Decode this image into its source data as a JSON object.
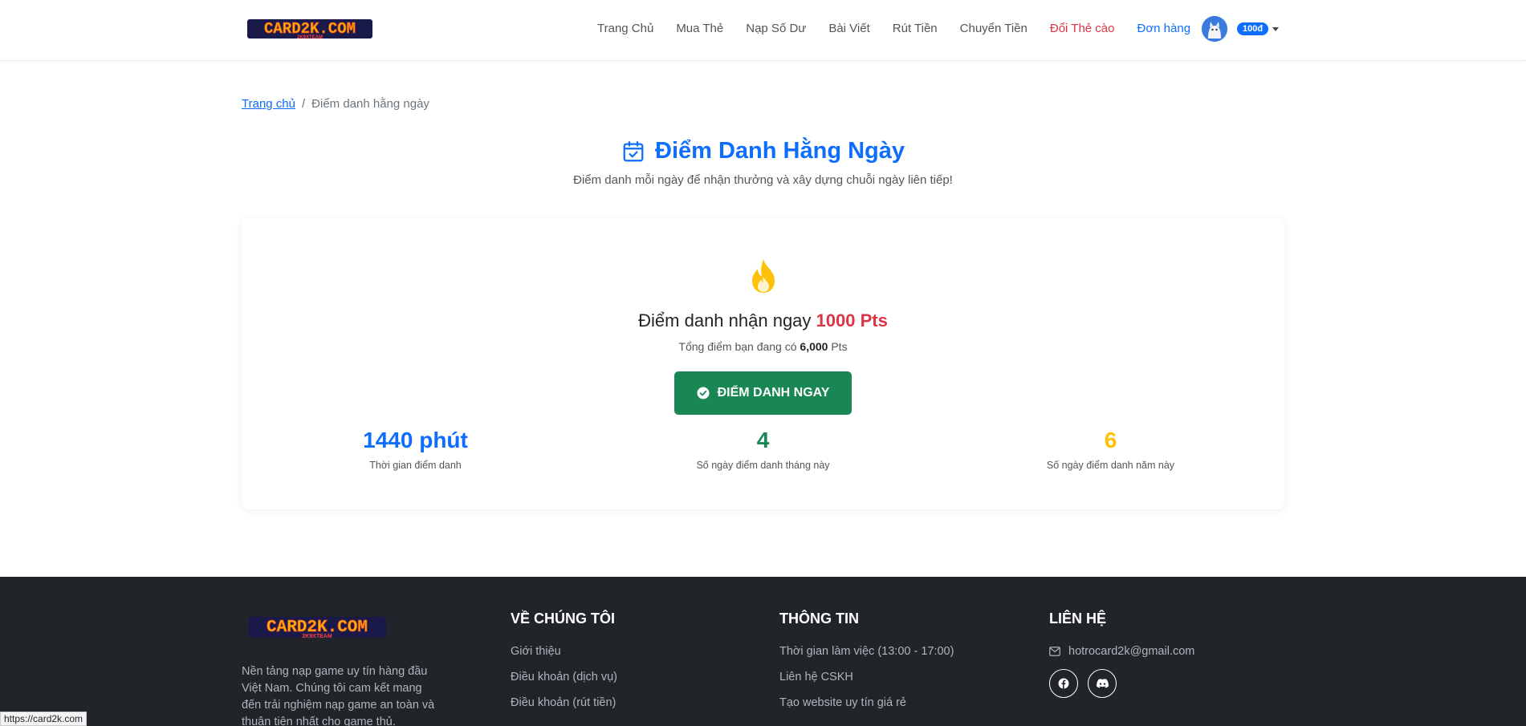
{
  "brand": {
    "logo_text": "CARD2K.COM",
    "logo_sub": "2K9XTEAM"
  },
  "nav": {
    "items": [
      {
        "label": "Trang Chủ"
      },
      {
        "label": "Mua Thẻ"
      },
      {
        "label": "Nạp Số Dư"
      },
      {
        "label": "Bài Viết"
      },
      {
        "label": "Rút Tiền"
      },
      {
        "label": "Chuyển Tiền"
      },
      {
        "label": "Đổi Thẻ cào"
      },
      {
        "label": "Đơn hàng"
      }
    ],
    "balance": "100đ"
  },
  "breadcrumb": {
    "home": "Trang chủ",
    "separator": "/",
    "current": "Điểm danh hằng ngày"
  },
  "page": {
    "title": "Điểm Danh Hằng Ngày",
    "subtitle": "Điểm danh mỗi ngày để nhận thưởng và xây dựng chuỗi ngày liên tiếp!"
  },
  "checkin": {
    "reward_prefix": "Điểm danh nhận ngay",
    "reward_value": "1000 Pts",
    "total_prefix": "Tổng điểm bạn đang có",
    "total_value": "6,000",
    "total_suffix": "Pts",
    "button_label": "ĐIỂM DANH NGAY",
    "stats": [
      {
        "value": "1440 phút",
        "label": "Thời gian điểm danh"
      },
      {
        "value": "4",
        "label": "Số ngày điểm danh tháng này"
      },
      {
        "value": "6",
        "label": "Số ngày điểm danh năm này"
      }
    ]
  },
  "footer": {
    "about": "Nền tảng nạp game uy tín hàng đầu Việt Nam. Chúng tôi cam kết mang đến trải nghiệm nạp game an toàn và thuận tiện nhất cho game thủ.",
    "about_us": {
      "heading": "VỀ CHÚNG TÔI",
      "items": [
        "Giới thiệu",
        "Điều khoản (dịch vụ)",
        "Điều khoản (rút tiền)"
      ]
    },
    "info": {
      "heading": "THÔNG TIN",
      "items": [
        "Thời gian làm việc (13:00 - 17:00)",
        "Liên hệ CSKH",
        "Tạo website uy tín giá rẻ"
      ]
    },
    "contact": {
      "heading": "LIÊN HỆ",
      "email": "hotrocard2k@gmail.com"
    }
  },
  "status_bar": {
    "url": "https://card2k.com"
  },
  "colors": {
    "primary": "#0d6efd",
    "success": "#198754",
    "danger": "#dc3545",
    "warning": "#ffc107",
    "footer_bg": "#212529"
  }
}
